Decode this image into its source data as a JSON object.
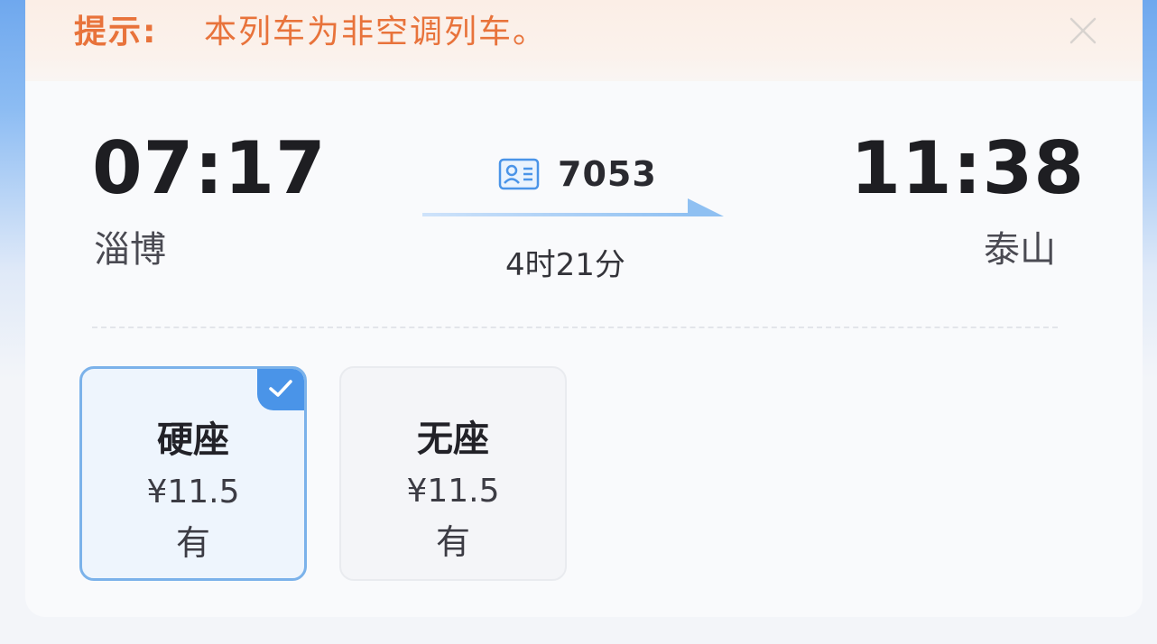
{
  "notice": {
    "label": "提示:",
    "text": "本列车为非空调列车。"
  },
  "trip": {
    "departure": {
      "time": "07:17",
      "station": "淄博"
    },
    "arrival": {
      "time": "11:38",
      "station": "泰山"
    },
    "train_number": "7053",
    "duration": "4时21分"
  },
  "seats": [
    {
      "name": "硬座",
      "price": "¥11.5",
      "availability": "有",
      "selected": true
    },
    {
      "name": "无座",
      "price": "¥11.5",
      "availability": "有",
      "selected": false
    }
  ],
  "colors": {
    "notice_text": "#e8733b",
    "selected_border": "#7bb2ea",
    "check_badge": "#4a94e8",
    "arrow": "#8fc0f2"
  },
  "icons": {
    "close": "close-icon",
    "train_id": "id-card-icon",
    "arrow": "right-arrow-icon",
    "selected": "checkmark-icon"
  }
}
